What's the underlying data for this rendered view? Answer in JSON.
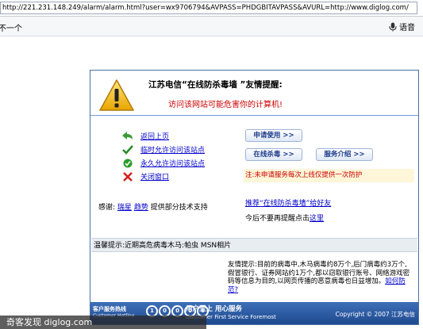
{
  "browser": {
    "url": "http://221.231.148.249/alarm/alarm.html?user=wx9706794&AVPASS=PHDGBITAVPASS&AVURL=http://www.diglog.com/",
    "toolbar_left": "不一个",
    "voice_label": "语音"
  },
  "dialog": {
    "title": "江苏电信“在线防杀毒墙 ”友情提醒:",
    "warning": "访问该网站可能危害你的计算机!",
    "links": [
      {
        "label": "返回上页",
        "icon": "back-arrow-icon"
      },
      {
        "label": "临时允许访问该站点",
        "icon": "check-icon"
      },
      {
        "label": "永久允许访问该站点",
        "icon": "green-check-circle-icon"
      },
      {
        "label": "关闭窗口",
        "icon": "red-x-icon"
      }
    ],
    "credits": {
      "prefix": "感谢:",
      "partner1": "瑞星",
      "partner2": "趋势",
      "suffix": "提供部分技术支持"
    },
    "buttons": {
      "apply": "申请使用 >>",
      "online_kill": "在线杀毒 >>",
      "service": "服务介绍 >>"
    },
    "note": "注:未申请服务每次上线仅提供一次防护",
    "recommend": "推荐“在线防杀毒墙”给好友",
    "today": {
      "prefix": "今后不要再提醒点击",
      "link": "这里"
    },
    "tip": "温馨提示:近期高危病毒木马:帕虫 MSN相片",
    "friendly": {
      "text": "友情提示:目前的病毒中,木马病毒约8万个,后门病毒约3万个,假冒银行、证券网站约1万个,都以窃取银行账号、网络游戏密码等信息为目的,以网页传播的恶意病毒也日益增加。",
      "link": "如何防范?"
    },
    "footer": {
      "hotline": "客户服务热线",
      "hotline_en": "Customer Hotline",
      "number_digits": [
        "1",
        "0",
        "0",
        "0",
        "0"
      ],
      "slogan": "用户至上 用心服务",
      "slogan_en": "Customer First Service Foremost",
      "copyright": "Copyright © 2007 江苏电信"
    }
  },
  "watermark": "奇客发现 diglog.com",
  "colors": {
    "accent": "#4a6fa6",
    "warning": "#cc0000",
    "link": "#0000cc"
  }
}
